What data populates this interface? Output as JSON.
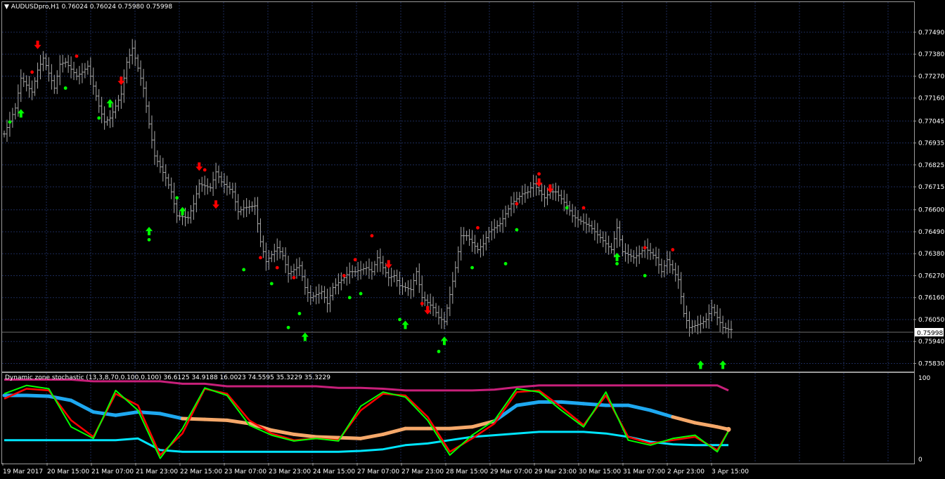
{
  "window": {
    "menu_marker": "▼",
    "symbol_line": "AUDUSDpro,H1  0.76024 0.76024 0.75980 0.75998",
    "current_price_label": "0.75998"
  },
  "indicator": {
    "title": "Dynamic zone stochastic (13,3,8,70,0.100,0.100) 36.6125 34.9188 16.0023 74.5595 35.3229 35.3229",
    "scale_top": "100",
    "scale_bottom": "0"
  },
  "colors": {
    "background": "#000000",
    "grid": "#1c2a58",
    "bars": "#a8a8a8",
    "bull_arrow": "#00ff00",
    "bear_arrow": "#ff0000",
    "stoch_green": "#00ff00",
    "stoch_red": "#ff0000",
    "upper_zone": "#c8207a",
    "lower_zone": "#00e5ff",
    "mid_blue": "#1ea8f0",
    "mid_orange": "#f5a86a"
  },
  "chart_data": [
    {
      "type": "ohlc",
      "symbol": "AUDUSDpro",
      "timeframe": "H1",
      "last": {
        "open": 0.76024,
        "high": 0.76024,
        "low": 0.7598,
        "close": 0.75998
      },
      "y_ticks": [
        0.7749,
        0.7738,
        0.7727,
        0.7716,
        0.77045,
        0.76935,
        0.76825,
        0.76715,
        0.766,
        0.7649,
        0.7638,
        0.7627,
        0.7616,
        0.7605,
        0.7594,
        0.7583
      ],
      "y_tick_labels": [
        "0.77490",
        "0.77380",
        "0.77270",
        "0.77160",
        "0.77045",
        "0.76935",
        "0.76825",
        "0.76715",
        "0.76600",
        "0.76490",
        "0.76380",
        "0.76270",
        "0.76160",
        "0.76050",
        "0.75940",
        "0.75830"
      ],
      "ylim": [
        0.758,
        0.7756
      ],
      "close_path": [
        [
          0,
          0.7698
        ],
        [
          2,
          0.7711
        ],
        [
          3,
          0.7726
        ],
        [
          5,
          0.7719
        ],
        [
          6,
          0.773
        ],
        [
          7,
          0.7736
        ],
        [
          9,
          0.7721
        ],
        [
          10,
          0.7733
        ],
        [
          11,
          0.7734
        ],
        [
          13,
          0.7727
        ],
        [
          14,
          0.7729
        ],
        [
          15,
          0.7732
        ],
        [
          17,
          0.7712
        ],
        [
          18,
          0.7704
        ],
        [
          19,
          0.7706
        ],
        [
          21,
          0.7718
        ],
        [
          22,
          0.7734
        ],
        [
          23,
          0.7741
        ],
        [
          25,
          0.7721
        ],
        [
          26,
          0.7703
        ],
        [
          27,
          0.7687
        ],
        [
          29,
          0.7676
        ],
        [
          30,
          0.7669
        ],
        [
          31,
          0.7657
        ],
        [
          33,
          0.7656
        ],
        [
          34,
          0.7663
        ],
        [
          35,
          0.7673
        ],
        [
          37,
          0.7671
        ],
        [
          38,
          0.7679
        ],
        [
          39,
          0.7674
        ],
        [
          41,
          0.7669
        ],
        [
          42,
          0.7659
        ],
        [
          43,
          0.7661
        ],
        [
          45,
          0.7662
        ],
        [
          46,
          0.7644
        ],
        [
          47,
          0.7634
        ],
        [
          49,
          0.7641
        ],
        [
          50,
          0.7637
        ],
        [
          51,
          0.7628
        ],
        [
          53,
          0.7632
        ],
        [
          54,
          0.7621
        ],
        [
          55,
          0.7616
        ],
        [
          57,
          0.7619
        ],
        [
          58,
          0.7613
        ],
        [
          59,
          0.7621
        ],
        [
          61,
          0.7626
        ],
        [
          62,
          0.7629
        ],
        [
          63,
          0.7629
        ],
        [
          65,
          0.7631
        ],
        [
          66,
          0.7629
        ],
        [
          67,
          0.7636
        ],
        [
          69,
          0.7626
        ],
        [
          70,
          0.7627
        ],
        [
          71,
          0.7622
        ],
        [
          73,
          0.762
        ],
        [
          74,
          0.7629
        ],
        [
          75,
          0.7616
        ],
        [
          77,
          0.7611
        ],
        [
          78,
          0.7606
        ],
        [
          79,
          0.7604
        ],
        [
          81,
          0.7631
        ],
        [
          82,
          0.7647
        ],
        [
          83,
          0.7647
        ],
        [
          85,
          0.764
        ],
        [
          86,
          0.7643
        ],
        [
          87,
          0.7649
        ],
        [
          89,
          0.7653
        ],
        [
          90,
          0.7658
        ],
        [
          91,
          0.7663
        ],
        [
          93,
          0.7668
        ],
        [
          94,
          0.7669
        ],
        [
          95,
          0.7673
        ],
        [
          97,
          0.7666
        ],
        [
          98,
          0.7669
        ],
        [
          99,
          0.7669
        ],
        [
          101,
          0.7662
        ],
        [
          102,
          0.7657
        ],
        [
          103,
          0.7655
        ],
        [
          105,
          0.7652
        ],
        [
          106,
          0.7649
        ],
        [
          107,
          0.7646
        ],
        [
          109,
          0.764
        ],
        [
          110,
          0.7651
        ],
        [
          111,
          0.7639
        ],
        [
          113,
          0.7636
        ],
        [
          114,
          0.7638
        ],
        [
          115,
          0.7641
        ],
        [
          117,
          0.7636
        ],
        [
          118,
          0.7629
        ],
        [
          119,
          0.7635
        ],
        [
          121,
          0.7625
        ],
        [
          122,
          0.7608
        ],
        [
          123,
          0.7601
        ],
        [
          125,
          0.7603
        ],
        [
          126,
          0.7605
        ],
        [
          127,
          0.7611
        ],
        [
          129,
          0.7601
        ],
        [
          130,
          0.76
        ]
      ],
      "x_tick_labels": [
        "19 Mar 2017",
        "20 Mar 15:00",
        "21 Mar 07:00",
        "21 Mar 23:00",
        "22 Mar 15:00",
        "23 Mar 07:00",
        "23 Mar 23:00",
        "24 Mar 15:00",
        "27 Mar 07:00",
        "27 Mar 23:00",
        "28 Mar 15:00",
        "29 Mar 07:00",
        "29 Mar 23:00",
        "30 Mar 15:00",
        "31 Mar 07:00",
        "2 Apr 23:00",
        "3 Apr 15:00"
      ],
      "up_arrows": [
        [
          3,
          0.7708
        ],
        [
          19,
          0.7713
        ],
        [
          26,
          0.7649
        ],
        [
          32,
          0.7659
        ],
        [
          54,
          0.7596
        ],
        [
          72,
          0.7602
        ],
        [
          79,
          0.7594
        ],
        [
          110,
          0.7636
        ],
        [
          125,
          0.7582
        ],
        [
          129,
          0.7582
        ]
      ],
      "down_arrows": [
        [
          6,
          0.7743
        ],
        [
          21,
          0.7725
        ],
        [
          35,
          0.7682
        ],
        [
          38,
          0.7663
        ],
        [
          69,
          0.7633
        ],
        [
          76,
          0.761
        ],
        [
          96,
          0.7674
        ],
        [
          98,
          0.7671
        ]
      ],
      "green_dots": [
        [
          1,
          0.7704
        ],
        [
          11,
          0.7721
        ],
        [
          17,
          0.7706
        ],
        [
          26,
          0.7645
        ],
        [
          31,
          0.7666
        ],
        [
          43,
          0.763
        ],
        [
          48,
          0.7623
        ],
        [
          51,
          0.7601
        ],
        [
          53,
          0.7608
        ],
        [
          62,
          0.7616
        ],
        [
          64,
          0.7618
        ],
        [
          71,
          0.7605
        ],
        [
          78,
          0.7589
        ],
        [
          84,
          0.7631
        ],
        [
          90,
          0.7633
        ],
        [
          92,
          0.765
        ],
        [
          101,
          0.7661
        ],
        [
          110,
          0.7633
        ],
        [
          115,
          0.7627
        ],
        [
          125,
          0.7582
        ]
      ],
      "red_dots": [
        [
          5,
          0.7729
        ],
        [
          13,
          0.7737
        ],
        [
          36,
          0.768
        ],
        [
          46,
          0.7636
        ],
        [
          49,
          0.7631
        ],
        [
          52,
          0.7626
        ],
        [
          61,
          0.7627
        ],
        [
          63,
          0.7635
        ],
        [
          66,
          0.7647
        ],
        [
          75,
          0.7613
        ],
        [
          85,
          0.7651
        ],
        [
          92,
          0.7663
        ],
        [
          96,
          0.7678
        ],
        [
          104,
          0.7661
        ],
        [
          115,
          0.7641
        ],
        [
          120,
          0.764
        ]
      ]
    },
    {
      "type": "line",
      "name": "Dynamic zone stochastic",
      "ylim": [
        0,
        100
      ],
      "x": [
        0,
        4,
        8,
        12,
        16,
        20,
        24,
        28,
        32,
        36,
        40,
        44,
        48,
        52,
        56,
        60,
        64,
        68,
        72,
        76,
        80,
        84,
        88,
        92,
        96,
        100,
        104,
        108,
        112,
        116,
        120,
        124,
        128,
        130
      ],
      "series": [
        {
          "key": "upper",
          "values": [
            97,
            97,
            97,
            97,
            95,
            95,
            95,
            95,
            92,
            92,
            89,
            89,
            89,
            89,
            89,
            87,
            87,
            86,
            84,
            84,
            84,
            84,
            85,
            88,
            90,
            90,
            90,
            90,
            90,
            90,
            90,
            90,
            90,
            84
          ]
        },
        {
          "key": "lower",
          "values": [
            24,
            24,
            24,
            24,
            24,
            24,
            26,
            12,
            10,
            10,
            10,
            10,
            10,
            10,
            10,
            10,
            11,
            13,
            18,
            20,
            24,
            28,
            30,
            32,
            34,
            34,
            34,
            32,
            28,
            22,
            19,
            18,
            18,
            18
          ]
        },
        {
          "key": "mid",
          "values": [
            78,
            78,
            77,
            72,
            58,
            54,
            58,
            56,
            50,
            49,
            48,
            44,
            36,
            31,
            28,
            27,
            26,
            31,
            38,
            38,
            38,
            40,
            47,
            66,
            70,
            70,
            68,
            66,
            66,
            60,
            52,
            45,
            40,
            37
          ]
        },
        {
          "key": "stoch_k",
          "values": [
            80,
            90,
            86,
            40,
            26,
            84,
            60,
            2,
            38,
            87,
            78,
            42,
            30,
            23,
            26,
            23,
            65,
            82,
            76,
            48,
            6,
            30,
            48,
            86,
            82,
            60,
            40,
            82,
            24,
            18,
            26,
            30,
            10,
            35
          ]
        },
        {
          "key": "stoch_d",
          "values": [
            74,
            86,
            84,
            48,
            28,
            80,
            66,
            6,
            32,
            86,
            80,
            48,
            32,
            24,
            26,
            24,
            60,
            80,
            78,
            52,
            10,
            26,
            44,
            82,
            84,
            64,
            42,
            78,
            28,
            20,
            24,
            28,
            12,
            35
          ]
        }
      ]
    }
  ]
}
